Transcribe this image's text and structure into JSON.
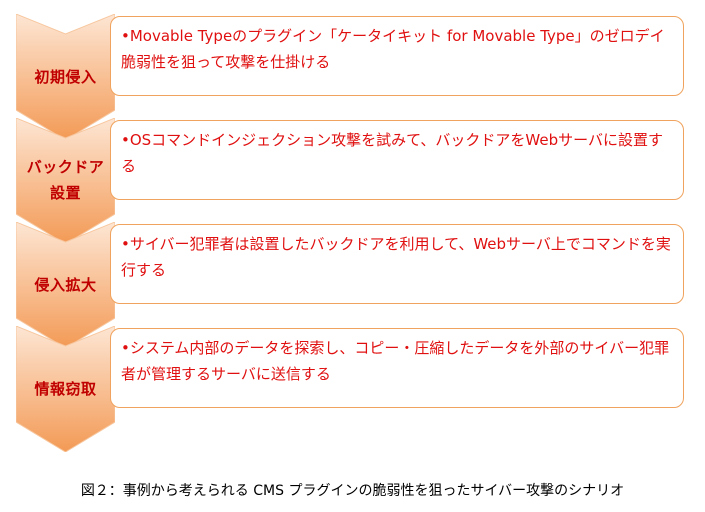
{
  "steps": [
    {
      "label_lines": [
        "初期侵入"
      ],
      "text": "•Movable Typeのプラグイン「ケータイキット for Movable Type」のゼロデイ脆弱性を狙って攻撃を仕掛ける"
    },
    {
      "label_lines": [
        "バックドア",
        "設置"
      ],
      "text": "•OSコマンドインジェクション攻撃を試みて、バックドアをWebサーバに設置する"
    },
    {
      "label_lines": [
        "侵入拡大"
      ],
      "text": "•サイバー犯罪者は設置したバックドアを利用して、Webサーバ上でコマンドを実行する"
    },
    {
      "label_lines": [
        "情報窃取"
      ],
      "text": "•システム内部のデータを探索し、コピー・圧縮したデータを外部のサイバー犯罪者が管理するサーバに送信する"
    }
  ],
  "caption": "図２：事例から考えられる CMS プラグインの脆弱性を狙ったサイバー攻撃のシナリオ",
  "colors": {
    "chevron_top": "#fde3cf",
    "chevron_bottom": "#f4a262",
    "chevron_edge": "#f7c79f",
    "label": "#c00000",
    "box_border": "#f0a35e",
    "box_text": "#e01010"
  }
}
